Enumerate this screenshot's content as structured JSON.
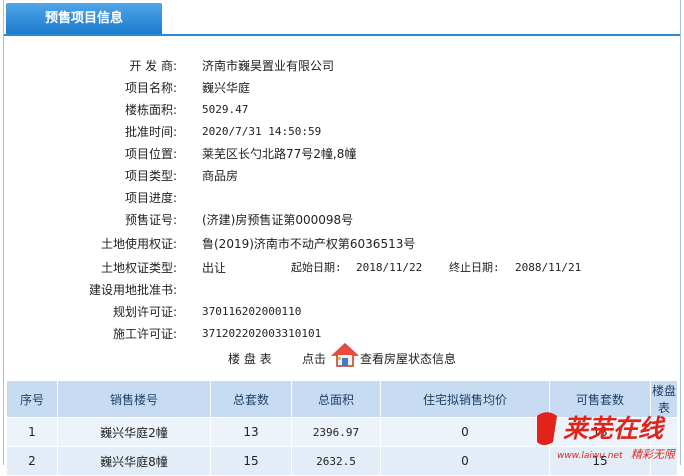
{
  "tab": {
    "title": "预售项目信息"
  },
  "info": [
    {
      "label": "开 发 商:",
      "value": "济南市巍昊置业有限公司"
    },
    {
      "label": "项目名称:",
      "value": "巍兴华庭"
    },
    {
      "label": "楼栋面积:",
      "value": "5029.47"
    },
    {
      "label": "批准时间:",
      "value": "2020/7/31 14:50:59"
    },
    {
      "label": "项目位置:",
      "value": "莱芜区长勺北路77号2幢,8幢"
    },
    {
      "label": "项目类型:",
      "value": "商品房"
    },
    {
      "label": "项目进度:",
      "value": ""
    },
    {
      "label": "预售证号:",
      "value": "(济建)房预售证第000098号"
    },
    {
      "label": "土地使用权证:",
      "value": "鲁(2019)济南市不动产权第6036513号"
    },
    {
      "label": "土地权证类型:",
      "value": "出让"
    },
    {
      "label": "建设用地批准书:",
      "value": ""
    },
    {
      "label": "规划许可证:",
      "value": "370116202000110"
    },
    {
      "label": "施工许可证:",
      "value": "371202202003310101"
    }
  ],
  "land_dates": {
    "start_label": "起始日期:",
    "start": "2018/11/22",
    "end_label": "终止日期:",
    "end": "2088/11/21"
  },
  "building_table": {
    "title": "楼 盘 表",
    "click_prefix": "点击",
    "link_text": "查看房屋状态信息"
  },
  "table": {
    "headers": [
      "序号",
      "销售楼号",
      "总套数",
      "总面积",
      "住宅拟销售均价",
      "可售套数",
      "楼盘表"
    ],
    "rows": [
      [
        "1",
        "巍兴华庭2幢",
        "13",
        "2396.97",
        "0",
        "13",
        ""
      ],
      [
        "2",
        "巍兴华庭8幢",
        "15",
        "2632.5",
        "0",
        "15",
        ""
      ]
    ]
  },
  "watermark": {
    "name": "莱芜在线",
    "url": "www.laiwu.net",
    "slogan": "精彩无限"
  },
  "colors": {
    "tab": "#2b89d3",
    "header_bg": "#c7dcf2",
    "row_bg": "#edf3fa",
    "logo_red": "#e2231a"
  }
}
